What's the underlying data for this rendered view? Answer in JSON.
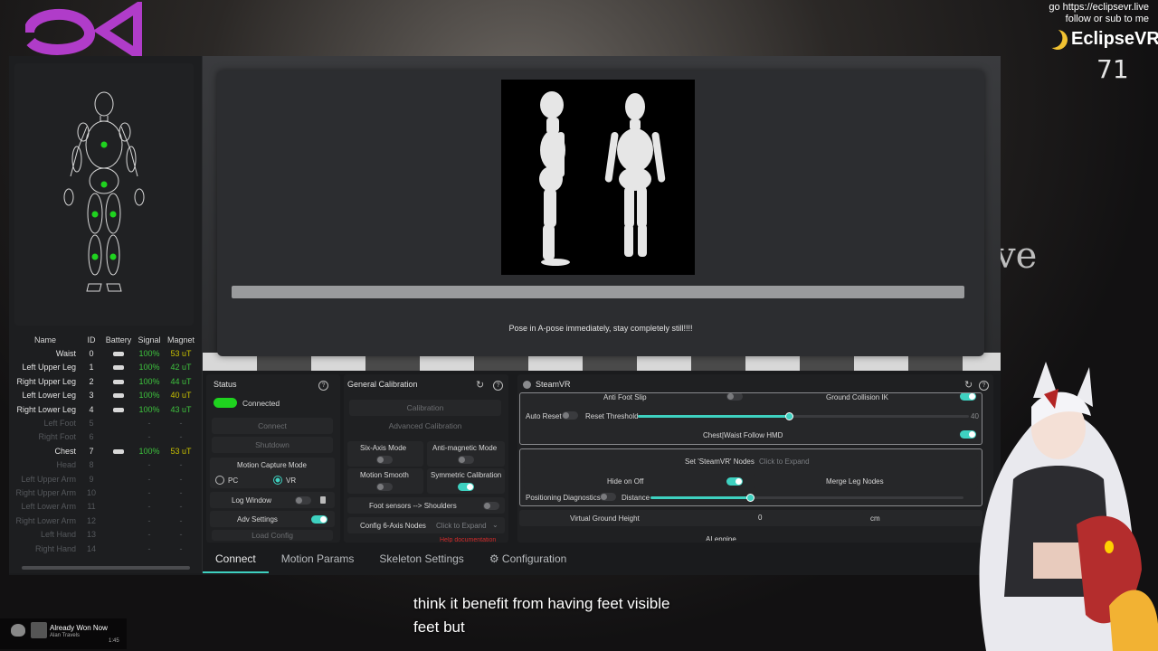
{
  "overlay": {
    "link_line": "go https://eclipsevr.live",
    "follow_line": "follow or sub to me",
    "brand": "EclipseVR",
    "counter": "71",
    "bg_text": "ve",
    "subtitle_line1": "think it benefit from having feet visible",
    "subtitle_line2": "feet but"
  },
  "now_playing": {
    "title": "Already Won Now",
    "artist": "Alan Travels",
    "time": "1:45"
  },
  "sensor_table": {
    "headers": [
      "Name",
      "ID",
      "Battery",
      "Signal",
      "Magnet"
    ],
    "rows": [
      {
        "name": "Waist",
        "id": "0",
        "signal": "100%",
        "magnet": "53 uT",
        "on": true,
        "mag_color": "yellow"
      },
      {
        "name": "Left Upper Leg",
        "id": "1",
        "signal": "100%",
        "magnet": "42 uT",
        "on": true,
        "mag_color": "green"
      },
      {
        "name": "Right Upper Leg",
        "id": "2",
        "signal": "100%",
        "magnet": "44 uT",
        "on": true,
        "mag_color": "green"
      },
      {
        "name": "Left Lower Leg",
        "id": "3",
        "signal": "100%",
        "magnet": "40 uT",
        "on": true,
        "mag_color": "yellow"
      },
      {
        "name": "Right Lower Leg",
        "id": "4",
        "signal": "100%",
        "magnet": "43 uT",
        "on": true,
        "mag_color": "green"
      },
      {
        "name": "Left Foot",
        "id": "5",
        "signal": "-",
        "magnet": "-",
        "on": false
      },
      {
        "name": "Right Foot",
        "id": "6",
        "signal": "-",
        "magnet": "-",
        "on": false
      },
      {
        "name": "Chest",
        "id": "7",
        "signal": "100%",
        "magnet": "53 uT",
        "on": true,
        "mag_color": "yellow"
      },
      {
        "name": "Head",
        "id": "8",
        "signal": "-",
        "magnet": "-",
        "on": false
      },
      {
        "name": "Left Upper Arm",
        "id": "9",
        "signal": "-",
        "magnet": "-",
        "on": false
      },
      {
        "name": "Right Upper Arm",
        "id": "10",
        "signal": "-",
        "magnet": "-",
        "on": false
      },
      {
        "name": "Left Lower Arm",
        "id": "11",
        "signal": "-",
        "magnet": "-",
        "on": false
      },
      {
        "name": "Right Lower Arm",
        "id": "12",
        "signal": "-",
        "magnet": "-",
        "on": false
      },
      {
        "name": "Left Hand",
        "id": "13",
        "signal": "-",
        "magnet": "-",
        "on": false
      },
      {
        "name": "Right Hand",
        "id": "14",
        "signal": "-",
        "magnet": "-",
        "on": false
      }
    ]
  },
  "dialog": {
    "instruction": "Pose in A-pose immediately, stay completely still!!!!"
  },
  "status": {
    "title": "Status",
    "state": "Connected",
    "connect_label": "Connect",
    "shutdown_label": "Shutdown",
    "mode_title": "Motion Capture Mode",
    "mode_pc": "PC",
    "mode_vr": "VR",
    "log_window": "Log Window",
    "adv_settings": "Adv Settings",
    "load_config": "Load Config"
  },
  "calibration": {
    "title": "General Calibration",
    "calibration_label": "Calibration",
    "advanced_label": "Advanced Calibration",
    "six_axis": "Six-Axis Mode",
    "anti_magnetic": "Anti-magnetic Mode",
    "motion_smooth": "Motion Smooth",
    "symmetric": "Symmetric Calibration",
    "foot_sensors": "Foot sensors --> Shoulders",
    "config_nodes": "Config 6-Axis Nodes",
    "click_expand": "Click to Expand",
    "help_link": "Help documentation"
  },
  "steamvr": {
    "title": "SteamVR",
    "anti_foot_slip": "Anti Foot Slip",
    "ground_collision": "Ground Collision IK",
    "auto_reset": "Auto Reset",
    "reset_threshold": "Reset Threshold",
    "reset_threshold_value": "40",
    "reset_threshold_fraction": 0.46,
    "chest_waist": "Chest|Waist Follow HMD",
    "set_nodes": "Set 'SteamVR' Nodes",
    "click_expand": "Click to Expand",
    "hide_on_off": "Hide on Off",
    "merge_leg": "Merge Leg Nodes",
    "positioning_diag": "Positioning Diagnostics",
    "distance": "Distance",
    "distance_fraction": 0.32,
    "virtual_ground": "Virtual Ground Height",
    "virtual_ground_value": "0",
    "unit": "cm",
    "ai_engine": "AI engine"
  },
  "tabs": [
    "Connect",
    "Motion Params",
    "Skeleton Settings",
    "Configuration"
  ],
  "colors": {
    "accent": "#3ed1c0",
    "connected": "#1fd31f",
    "signal": "#3ec33e",
    "magnet_warn": "#c8c100"
  }
}
